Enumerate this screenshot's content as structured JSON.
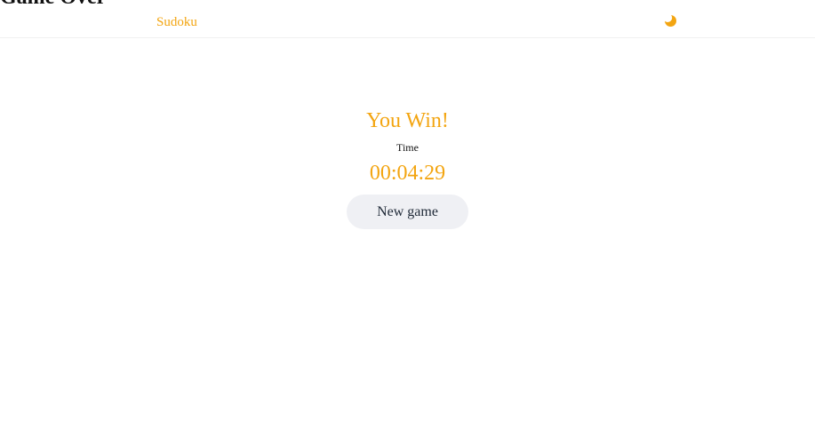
{
  "document": {
    "title": "Game Over"
  },
  "navbar": {
    "brand": "Sudoku",
    "theme_toggle_icon": "moon-icon",
    "accent_color": "#f3a511"
  },
  "result": {
    "heading": "You Win!",
    "time_label": "Time",
    "time_value": "00:04:29",
    "new_game_label": "New game"
  }
}
